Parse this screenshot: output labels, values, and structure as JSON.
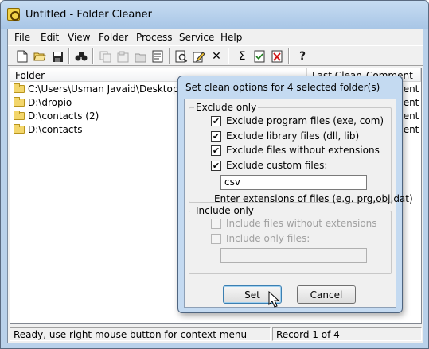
{
  "window": {
    "title": "Untitled - Folder Cleaner"
  },
  "menu": [
    "File",
    "Edit",
    "View",
    "Folder",
    "Process",
    "Service",
    "Help"
  ],
  "toolbar": {
    "icons": [
      "new-icon",
      "open-icon",
      "save-icon",
      "find-icon",
      "copy-icon",
      "properties-icon",
      "folder-properties-icon",
      "list-icon",
      "preview-icon",
      "edit-icon",
      "delete-icon",
      "sigma-icon",
      "check-icon",
      "close-doc-icon",
      "help-icon"
    ],
    "sigma_glyph": "Σ",
    "x_glyph": "✕",
    "help_glyph": "?"
  },
  "list": {
    "columns": [
      "Folder",
      "Last Clean",
      "Comment"
    ],
    "rows": [
      {
        "folder": "C:\\Users\\Usman Javaid\\Desktop\\Ter",
        "comment": "ment"
      },
      {
        "folder": "D:\\dropio",
        "comment": "ment"
      },
      {
        "folder": "D:\\contacts (2)",
        "comment": "ment"
      },
      {
        "folder": "D:\\contacts",
        "comment": "ment"
      }
    ]
  },
  "status": {
    "message": "Ready, use right mouse button for context menu",
    "record": "Record 1 of 4"
  },
  "dialog": {
    "title": "Set clean options for 4 selected folder(s)",
    "exclude_group": "Exclude only",
    "exclude_options": [
      {
        "label": "Exclude program files (exe, com)",
        "checked": true
      },
      {
        "label": "Exclude library files (dll, lib)",
        "checked": true
      },
      {
        "label": "Exclude files without extensions",
        "checked": true
      },
      {
        "label": "Exclude custom files:",
        "checked": true
      }
    ],
    "custom_value": "csv",
    "hint": "Enter extensions of files (e.g. prg,obj,dat)",
    "include_group": "Include only",
    "include_options": [
      {
        "label": "Include files without extensions",
        "checked": false
      },
      {
        "label": "Include only files:",
        "checked": false
      }
    ],
    "include_value": "",
    "set_label": "Set",
    "cancel_label": "Cancel",
    "check_glyph": "✔"
  }
}
